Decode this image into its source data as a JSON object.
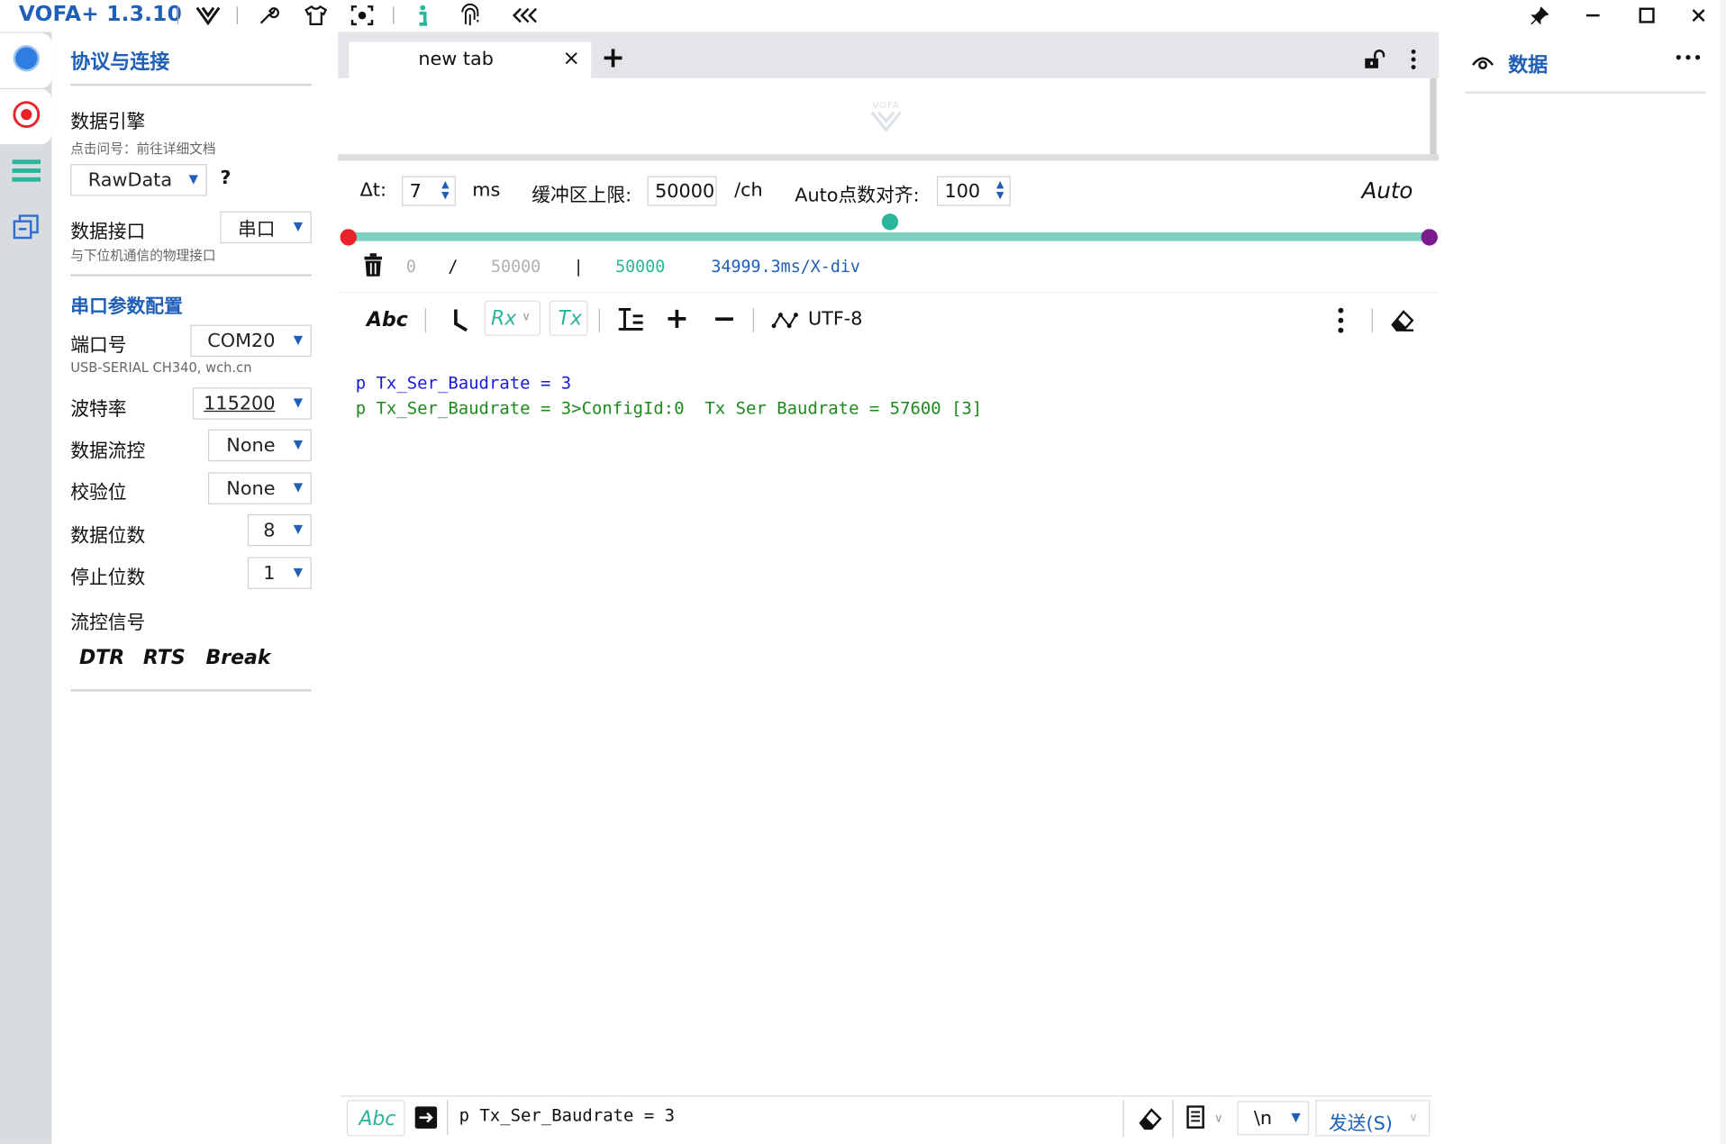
{
  "titlebar": {
    "app_name": "VOFA+ 1.3.10",
    "icons": [
      "vofa-logo-icon",
      "wrench-icon",
      "shirt-icon",
      "capture-icon",
      "info-icon",
      "fingerprint-icon",
      "collapse-icon"
    ],
    "window_controls": [
      "pin-icon",
      "minimize-icon",
      "maximize-icon",
      "close-icon"
    ]
  },
  "activity_bar": [
    "connection-icon",
    "record-icon",
    "menu-list-icon",
    "windows-icon"
  ],
  "left_panel": {
    "title": "协议与连接",
    "engine_label": "数据引擎",
    "engine_hint": "点击问号：前往详细文档",
    "engine_value": "RawData",
    "help": "?",
    "interface_label": "数据接口",
    "interface_hint": "与下位机通信的物理接口",
    "interface_value": "串口",
    "serial_section": "串口参数配置",
    "port_label": "端口号",
    "port_value": "COM20",
    "port_hint": "USB-SERIAL CH340, wch.cn",
    "baud_label": "波特率",
    "baud_value": "115200",
    "flow_label": "数据流控",
    "flow_value": "None",
    "parity_label": "校验位",
    "parity_value": "None",
    "databits_label": "数据位数",
    "databits_value": "8",
    "stopbits_label": "停止位数",
    "stopbits_value": "1",
    "signals_label": "流控信号",
    "signals": [
      "DTR",
      "RTS",
      "Break"
    ]
  },
  "center": {
    "tab_label": "new tab",
    "tab_close": "×",
    "add_tab": "+",
    "watermark": "VOFA",
    "dt_label": "Δt:",
    "dt_value": "7",
    "dt_unit": "ms",
    "buffer_label": "缓冲区上限:",
    "buffer_value": "50000",
    "buffer_unit": "/ch",
    "align_label": "Auto点数对齐:",
    "align_value": "100",
    "auto_label": "Auto",
    "slider_position": 0.5,
    "stats": {
      "current": "0",
      "sep1": "/",
      "total": "50000",
      "sep2": "|",
      "window": "50000",
      "xdiv": "34999.3ms/X-div"
    },
    "toolbar": {
      "abc": "Abc",
      "rx": "Rx",
      "tx": "Tx",
      "encoding": "UTF-8"
    },
    "log_lines": [
      {
        "text": "p Tx_Ser_Baudrate = 3",
        "color": "#1a1adb"
      },
      {
        "text": "p Tx_Ser_Baudrate = 3>ConfigId:0  Tx Ser Baudrate = 57600 [3]",
        "color": "#1e8a1e"
      }
    ],
    "send": {
      "abc": "Abc",
      "input_value": "p Tx_Ser_Baudrate = 3",
      "line_ending": "\\n",
      "send_label": "发送(S)"
    }
  },
  "right_panel": {
    "title": "数据",
    "more": "•••"
  },
  "colors": {
    "accent": "#1f5fb8",
    "teal": "#2bb59a",
    "slider_track": "#7fd0c0",
    "red": "#e8232b",
    "purple": "#7a1a8c"
  }
}
